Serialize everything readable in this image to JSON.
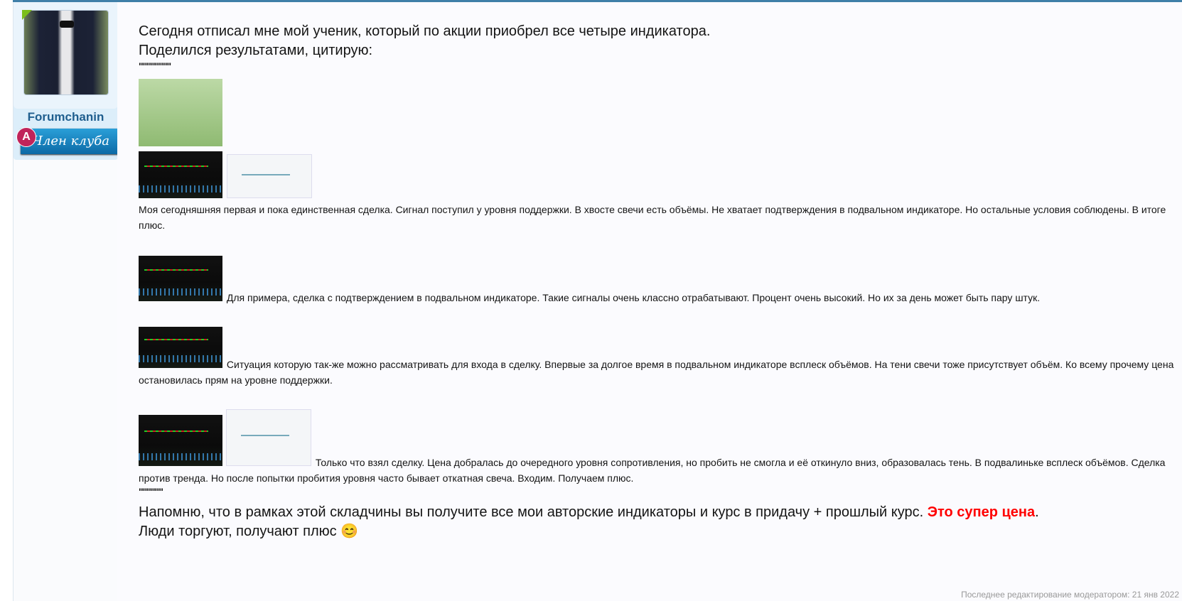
{
  "user": {
    "name": "Forumchanin",
    "badge_letter": "A",
    "badge_title": "Член клуба"
  },
  "post": {
    "intro_line1": "Сегодня отписал мне мой ученик, который по акции приобрел все четыре индикатора.",
    "intro_line2": "Поделился результатами, цитирую:",
    "quote_open": "\"\"\"\"\"\"\"\"",
    "para1": "Моя сегодняшняя первая и пока единственная сделка. Сигнал поступил у уровня поддержки. В хвосте свечи есть объёмы. Не хватает подтверждения в подвальном индикаторе. Но остальные условия соблюдены. В итоге плюс.",
    "para2": "Для примера, сделка с подтверждением в подвальном индикаторе. Такие сигналы очень классно отрабатывают. Процент очень высокий. Но их за день может быть пару штук.",
    "para3": "Ситуация которую так-же можно рассматривать для входа в сделку. Впервые за долгое время в подвальном индикаторе всплеск объёмов. На тени свечи тоже присутствует объём. Ко всему прочему цена остановилась прям на уровне поддержки.",
    "para4": "Только что взял сделку. Цена добралась до очередного уровня сопротивления, но пробить не смогла и её откинуло вниз, образовалась тень. В подвалиньке всплеск объёмов. Сделка против тренда. Но после попытки пробития уровня часто бывает откатная свеча. Входим. Получаем плюс.",
    "quote_close": "\"\"\"\"\"\"",
    "outro_line1": "Напомню, что в рамках этой складчины вы получите все мои авторские индикаторы и курс в придачу + прошлый курс. ",
    "outro_highlight": "Это супер цена",
    "outro_dot": ".",
    "outro_line2": "Люди торгуют, получают плюс ",
    "smiley": "😊"
  },
  "footer": {
    "edited": "Последнее редактирование модератором: 21 янв 2022"
  },
  "colors": {
    "accent": "#1f5e8e",
    "highlight": "#ff0000"
  }
}
